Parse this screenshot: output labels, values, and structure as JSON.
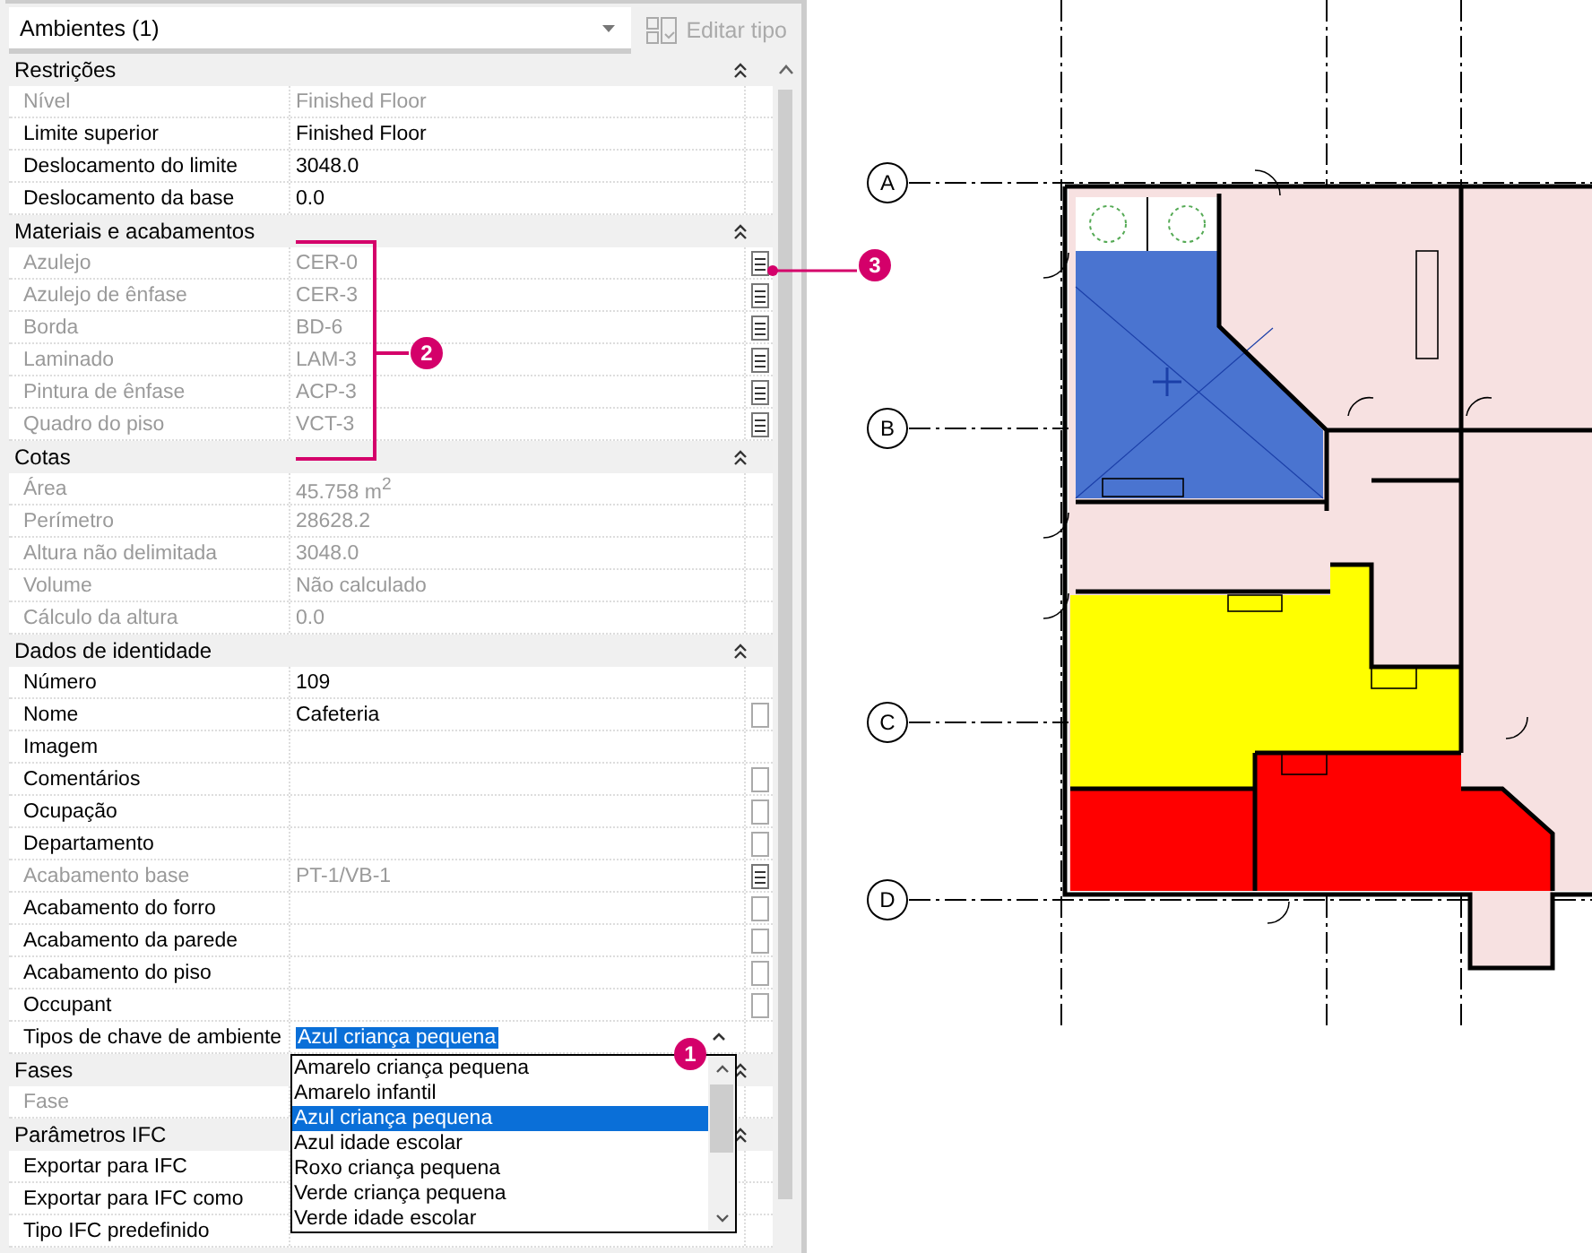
{
  "type_selector": {
    "value": "Ambientes (1)",
    "edit_button": {
      "label": "Editar tipo",
      "disabled": true
    }
  },
  "groups": [
    {
      "title": "Restrições",
      "rows": [
        {
          "name": "Nível",
          "value": "Finished Floor",
          "disabled": true,
          "kind": "plain"
        },
        {
          "name": "Limite superior",
          "value": "Finished Floor",
          "disabled": false,
          "kind": "plain"
        },
        {
          "name": "Deslocamento do limite",
          "value": "3048.0",
          "disabled": false,
          "kind": "plain"
        },
        {
          "name": "Deslocamento da base",
          "value": "0.0",
          "disabled": false,
          "kind": "plain"
        }
      ]
    },
    {
      "title": "Materiais e acabamentos",
      "rows": [
        {
          "name": "Azulejo",
          "value": "CER-0",
          "disabled": true,
          "kind": "browse"
        },
        {
          "name": "Azulejo de ênfase",
          "value": "CER-3",
          "disabled": true,
          "kind": "browse"
        },
        {
          "name": "Borda",
          "value": "BD-6",
          "disabled": true,
          "kind": "browse"
        },
        {
          "name": "Laminado",
          "value": "LAM-3",
          "disabled": true,
          "kind": "browse"
        },
        {
          "name": "Pintura de ênfase",
          "value": "ACP-3",
          "disabled": true,
          "kind": "browse"
        },
        {
          "name": "Quadro do piso",
          "value": "VCT-3",
          "disabled": true,
          "kind": "browse"
        }
      ]
    },
    {
      "title": "Cotas",
      "rows": [
        {
          "name": "Área",
          "value": "45.758 m$^{2}$",
          "disabled": true,
          "kind": "plain"
        },
        {
          "name": "Perímetro",
          "value": "28628.2",
          "disabled": true,
          "kind": "plain"
        },
        {
          "name": "Altura não delimitada",
          "value": "3048.0",
          "disabled": true,
          "kind": "plain"
        },
        {
          "name": "Volume",
          "value": "Não calculado",
          "disabled": true,
          "kind": "plain"
        },
        {
          "name": "Cálculo da altura",
          "value": "0.0",
          "disabled": true,
          "kind": "plain"
        }
      ]
    },
    {
      "title": "Dados de identidade",
      "rows": [
        {
          "name": "Número",
          "value": "109",
          "disabled": false,
          "kind": "plain"
        },
        {
          "name": "Nome",
          "value": "Cafeteria",
          "disabled": false,
          "kind": "text"
        },
        {
          "name": "Imagem",
          "disabled": false,
          "kind": "plain"
        },
        {
          "name": "Comentários",
          "disabled": false,
          "kind": "text"
        },
        {
          "name": "Ocupação",
          "disabled": false,
          "kind": "text"
        },
        {
          "name": "Departamento",
          "disabled": false,
          "kind": "text"
        },
        {
          "name": "Acabamento base",
          "value": "PT-1/VB-1",
          "disabled": true,
          "kind": "browse"
        },
        {
          "name": "Acabamento do forro",
          "disabled": false,
          "kind": "text"
        },
        {
          "name": "Acabamento da parede",
          "disabled": false,
          "kind": "text"
        },
        {
          "name": "Acabamento do piso",
          "disabled": false,
          "kind": "text"
        },
        {
          "name": "Occupant",
          "disabled": false,
          "kind": "text"
        },
        {
          "name": "Tipos de chave de ambiente",
          "value": "Azul criança pequena",
          "disabled": false,
          "kind": "plain",
          "open": true,
          "options": [
            {
              "label": "Amarelo criança pequena",
              "selected": false
            },
            {
              "label": "Amarelo infantil",
              "selected": false
            },
            {
              "label": "Azul criança pequena",
              "selected": true
            },
            {
              "label": "Azul idade escolar",
              "selected": false
            },
            {
              "label": "Roxo criança pequena",
              "selected": false
            },
            {
              "label": "Verde criança pequena",
              "selected": false
            },
            {
              "label": "Verde idade escolar",
              "selected": false
            }
          ]
        }
      ]
    },
    {
      "title": "Fases",
      "rows": [
        {
          "name": "Fase",
          "disabled": true,
          "kind": "plain"
        }
      ]
    },
    {
      "title": "Parâmetros IFC",
      "rows": [
        {
          "name": "Exportar para IFC",
          "disabled": false,
          "kind": "plain"
        },
        {
          "name": "Exportar para IFC como",
          "disabled": false,
          "kind": "plain"
        },
        {
          "name": "Tipo IFC predefinido",
          "disabled": false,
          "kind": "plain"
        }
      ]
    }
  ],
  "callouts": [
    {
      "number": "1"
    },
    {
      "number": "2"
    },
    {
      "number": "3"
    }
  ],
  "plan": {
    "grid_labels": [
      "A",
      "B",
      "C",
      "D"
    ],
    "rooms": [
      {
        "color": "#4a74d0"
      },
      {
        "color": "#f7e1e1"
      },
      {
        "color": "#ffff00"
      },
      {
        "color": "#ff0000"
      }
    ]
  }
}
